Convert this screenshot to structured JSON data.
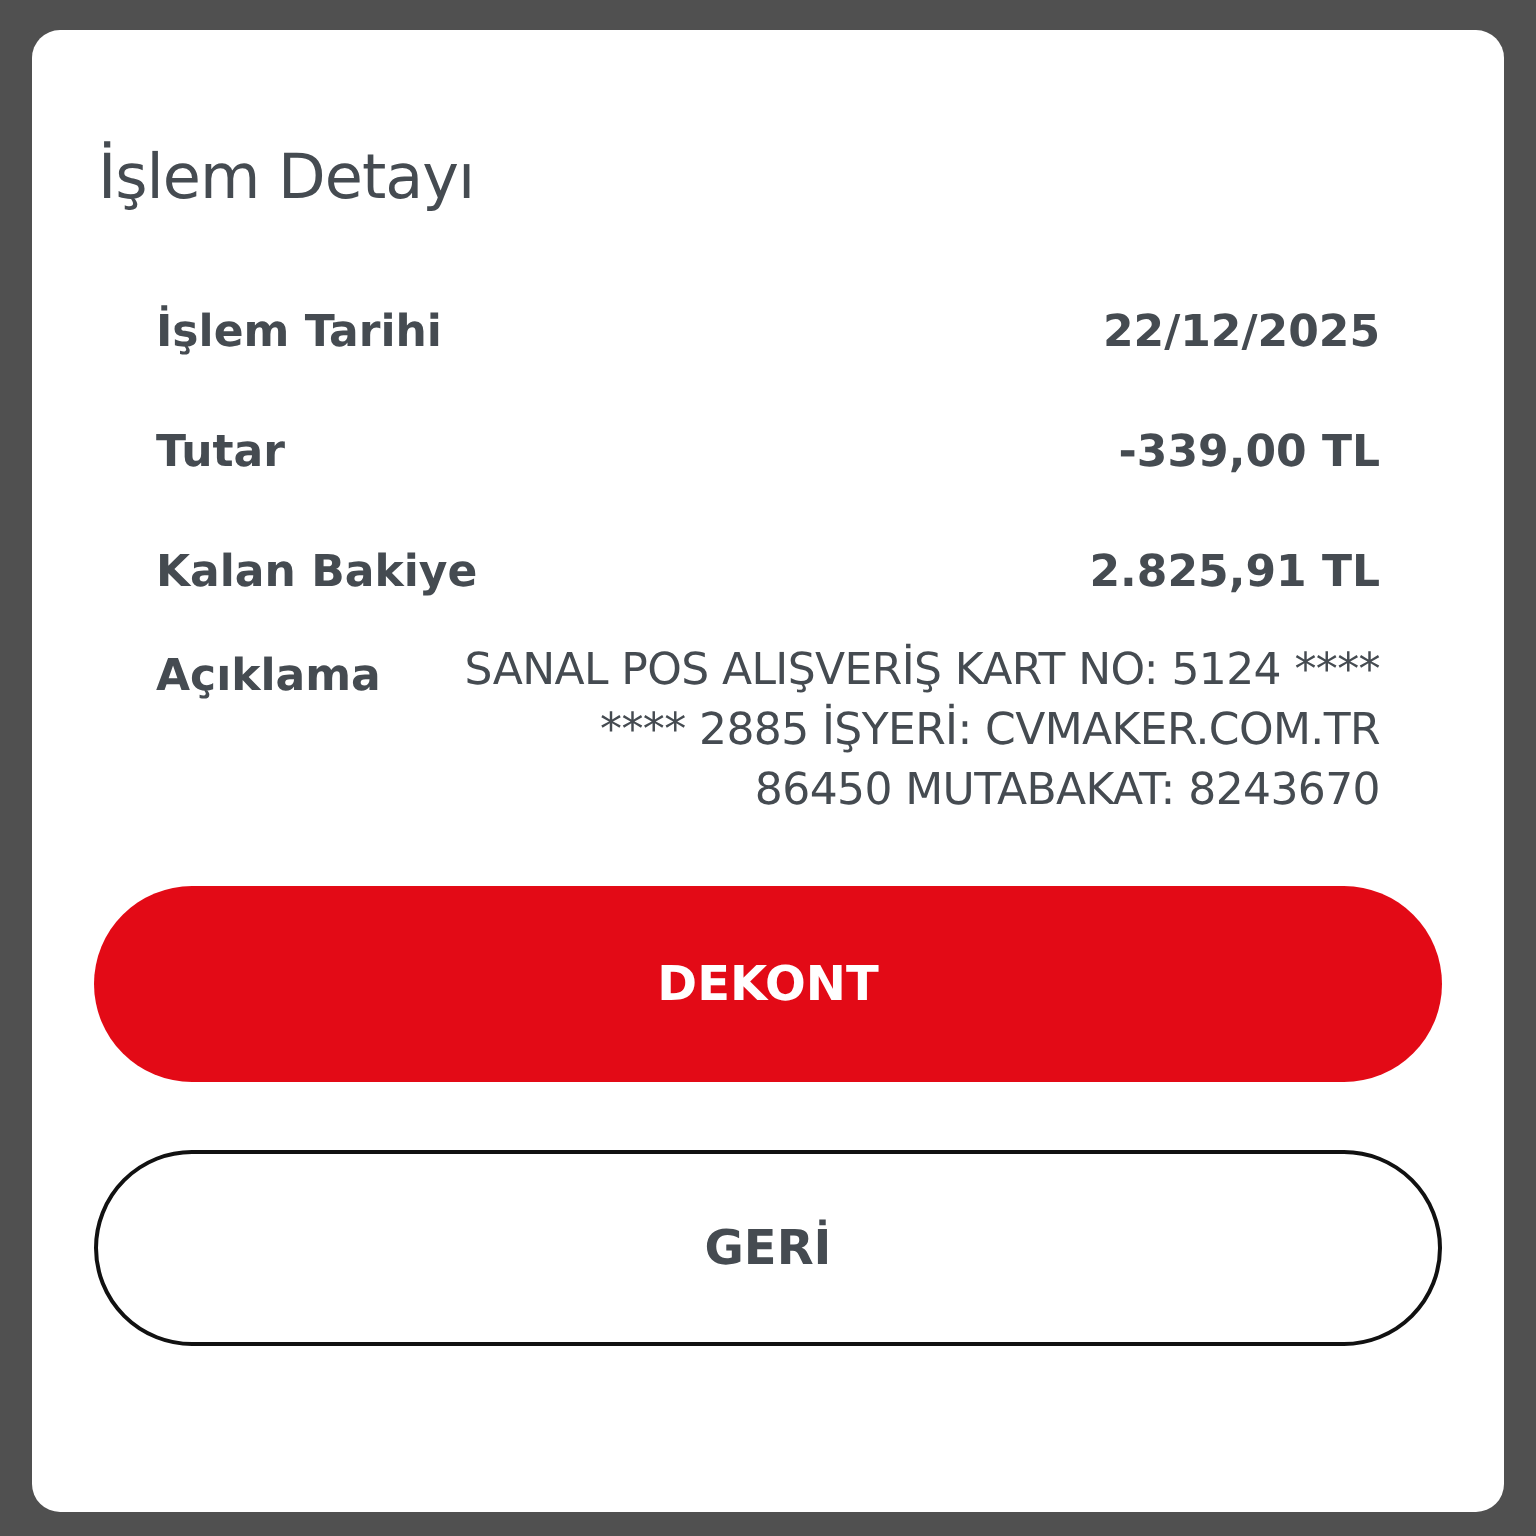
{
  "dialog": {
    "title": "İşlem Detayı",
    "rows": [
      {
        "label": "İşlem Tarihi",
        "value": "22/12/2025"
      },
      {
        "label": "Tutar",
        "value": "-339,00 TL"
      },
      {
        "label": "Kalan Bakiye",
        "value": "2.825,91 TL"
      }
    ],
    "description": {
      "label": "Açıklama",
      "value": "SANAL POS ALIŞVERİŞ KART NO: 5124 **** **** 2885 İŞYERİ: CVMAKER.COM.TR 86450 MUTABAKAT: 8243670"
    },
    "buttons": [
      {
        "label": "DEKONT",
        "kind": "primary"
      },
      {
        "label": "GERİ",
        "kind": "outline"
      }
    ]
  }
}
